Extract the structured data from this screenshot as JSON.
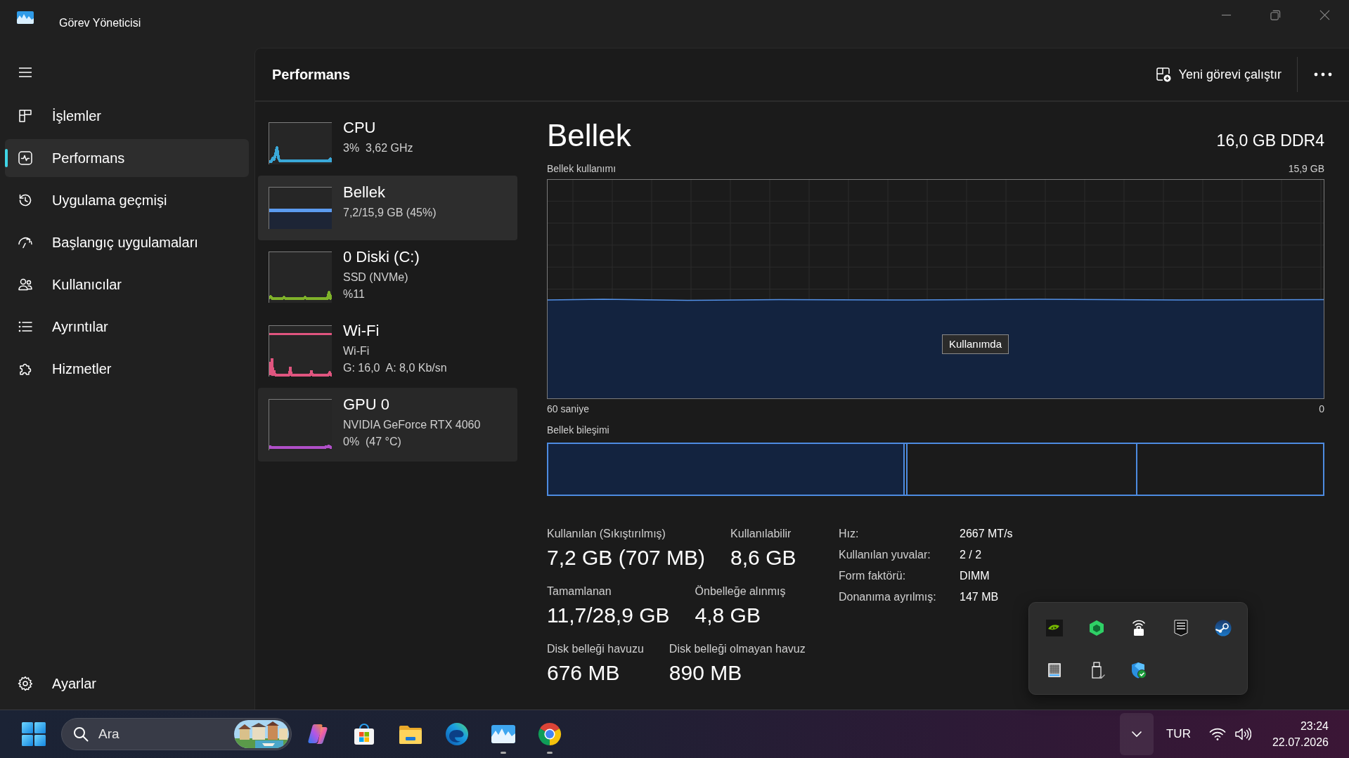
{
  "window": {
    "title": "Görev Yöneticisi"
  },
  "sidebar": {
    "items": [
      {
        "label": "İşlemler",
        "selected": false
      },
      {
        "label": "Performans",
        "selected": true
      },
      {
        "label": "Uygulama geçmişi",
        "selected": false
      },
      {
        "label": "Başlangıç uygulamaları",
        "selected": false
      },
      {
        "label": "Kullanıcılar",
        "selected": false
      },
      {
        "label": "Ayrıntılar",
        "selected": false
      },
      {
        "label": "Hizmetler",
        "selected": false
      }
    ],
    "settings": {
      "label": "Ayarlar"
    }
  },
  "page": {
    "title": "Performans",
    "new_task_button": "Yeni görevi çalıştır"
  },
  "resources": [
    {
      "kind": "cpu",
      "name": "CPU",
      "details": [
        "3%  3,62 GHz"
      ],
      "color": "#3aa8d8",
      "selected": false,
      "hovered": false
    },
    {
      "kind": "memory",
      "name": "Bellek",
      "details": [
        "7,2/15,9 GB (45%)"
      ],
      "color": "#5b9bf0",
      "selected": true,
      "hovered": false
    },
    {
      "kind": "disk",
      "name": "0 Diski (C:)",
      "details": [
        "SSD (NVMe)",
        "%11"
      ],
      "color": "#7fb22a",
      "selected": false,
      "hovered": false
    },
    {
      "kind": "network",
      "name": "Wi-Fi",
      "details": [
        "Wi-Fi",
        "G: 16,0  A: 8,0 Kb/sn"
      ],
      "color": "#e0557f",
      "selected": false,
      "hovered": false
    },
    {
      "kind": "gpu",
      "name": "GPU 0",
      "details": [
        "NVIDIA GeForce RTX 4060",
        "0%  (47 °C)"
      ],
      "color": "#b04fc8",
      "selected": false,
      "hovered": true
    }
  ],
  "detail": {
    "title": "Bellek",
    "spec": "16,0 GB DDR4",
    "usage_label": "Bellek kullanımı",
    "usage_max": "15,9 GB",
    "tooltip": "Kullanımda",
    "time_start": "60 saniye",
    "time_end": "0",
    "composition_label": "Bellek bileşimi",
    "stat_rows": [
      [
        {
          "label": "Kullanılan (Sıkıştırılmış)",
          "value": "7,2 GB (707 MB)"
        },
        {
          "label": "Kullanılabilir",
          "value": "8,6 GB"
        }
      ],
      [
        {
          "label": "Tamamlanan",
          "value": "11,7/28,9 GB"
        },
        {
          "label": "Önbelleğe alınmış",
          "value": "4,8 GB"
        }
      ],
      [
        {
          "label": "Disk belleği havuzu",
          "value": "676 MB"
        },
        {
          "label": "Disk belleği olmayan havuz",
          "value": "890 MB"
        }
      ]
    ],
    "properties": [
      {
        "label": "Hız:",
        "value": "2667 MT/s"
      },
      {
        "label": "Kullanılan yuvalar:",
        "value": "2 / 2"
      },
      {
        "label": "Form faktörü:",
        "value": "DIMM"
      },
      {
        "label": "Donanıma ayrılmış:",
        "value": "147 MB"
      }
    ]
  },
  "tray_overflow": {
    "expanded": true
  },
  "taskbar": {
    "search": {
      "placeholder": "Ara"
    },
    "apps": [
      {
        "running": false
      },
      {
        "running": false
      },
      {
        "running": false
      },
      {
        "running": false
      },
      {
        "running": true
      },
      {
        "running": true
      }
    ],
    "language": "TUR",
    "time": "23:24",
    "date": "22.07.2026"
  }
}
